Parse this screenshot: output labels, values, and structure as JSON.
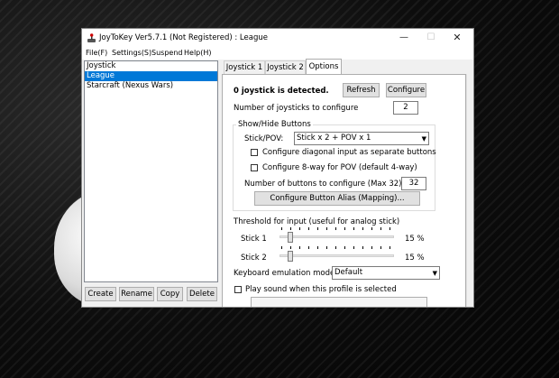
{
  "window": {
    "title": "JoyToKey Ver5.7.1 (Not Registered) : League"
  },
  "menu": [
    "File(F)",
    "Settings(S)",
    "Suspend",
    "Help(H)"
  ],
  "profiles": {
    "items": [
      {
        "label": "Joystick",
        "selected": false
      },
      {
        "label": "League",
        "selected": true
      },
      {
        "label": "Starcraft (Nexus Wars)",
        "selected": false
      }
    ],
    "buttons": {
      "create": "Create",
      "rename": "Rename",
      "copy": "Copy",
      "delete": "Delete"
    }
  },
  "tabs": [
    {
      "label": "Joystick 1",
      "active": false
    },
    {
      "label": "Joystick 2",
      "active": false
    },
    {
      "label": "Options",
      "active": true
    }
  ],
  "options": {
    "detected_text": "0 joystick is detected.",
    "refresh_label": "Refresh",
    "configure_label": "Configure",
    "num_joysticks_label": "Number of joysticks to configure",
    "num_joysticks_value": "2",
    "show_hide": {
      "title": "Show/Hide Buttons",
      "stick_pov_label": "Stick/POV:",
      "stick_pov_value": "Stick x 2 + POV x 1",
      "diagonal_label": "Configure diagonal input as separate buttons",
      "diagonal_checked": false,
      "eightway_label": "Configure 8-way for POV (default 4-way)",
      "eightway_checked": false,
      "num_buttons_label": "Number of buttons to configure (Max 32)",
      "num_buttons_value": "32",
      "alias_label": "Configure Button Alias (Mapping)..."
    },
    "threshold": {
      "title": "Threshold for input (useful for analog stick)",
      "stick1_label": "Stick 1",
      "stick1_value": "15 %",
      "stick1_level": 0.15,
      "stick2_label": "Stick 2",
      "stick2_value": "15 %",
      "stick2_level": 0.15
    },
    "keyboard_mode_label": "Keyboard emulation mode",
    "keyboard_mode_value": "Default",
    "play_sound_label": "Play sound when this profile is selected",
    "play_sound_checked": false
  },
  "colors": {
    "selection": "#0078d7",
    "window_bg": "#f0f0f0"
  }
}
